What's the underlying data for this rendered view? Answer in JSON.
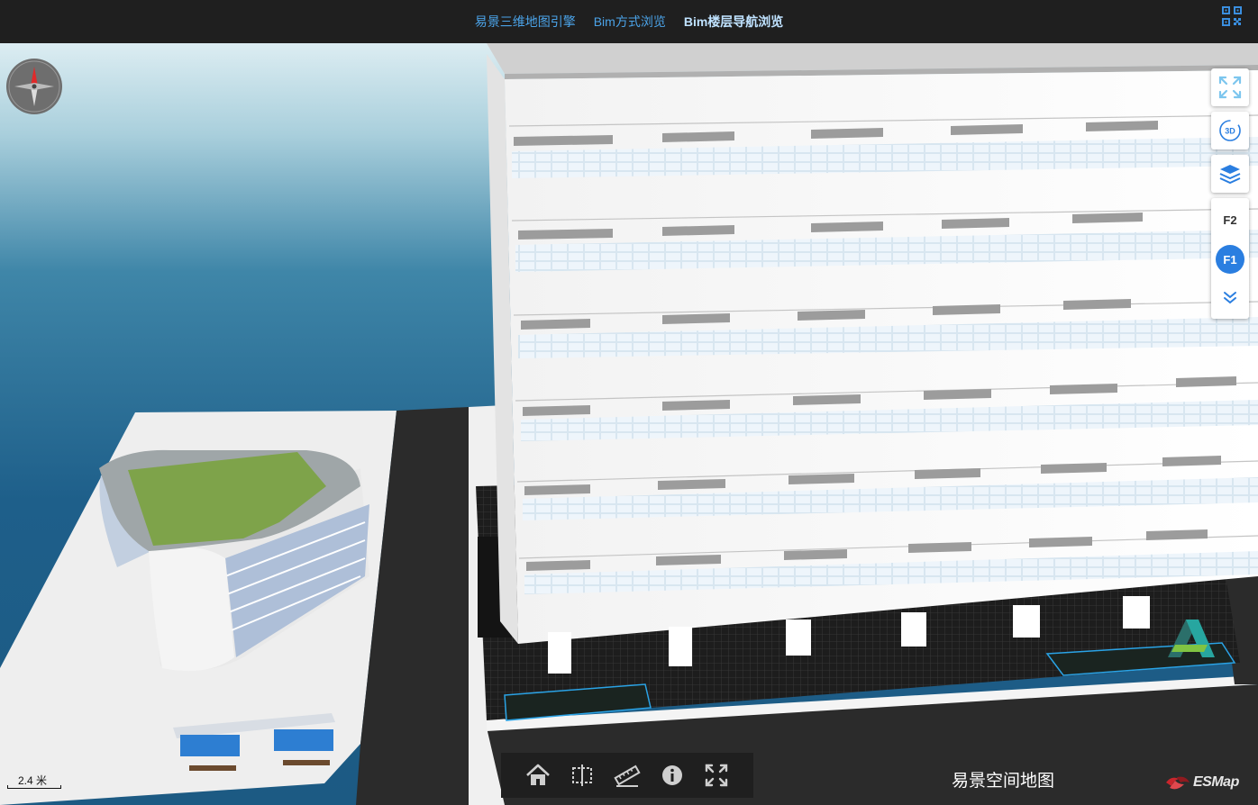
{
  "nav": {
    "items": [
      {
        "label": "易景三维地图引擎",
        "active": false
      },
      {
        "label": "Bim方式浏览",
        "active": false
      },
      {
        "label": "Bim楼层导航浏览",
        "active": true
      }
    ]
  },
  "tools": {
    "fullscreen_icon": "expand-icon",
    "view3d_label": "3D",
    "layers_icon": "layers-icon"
  },
  "floors": {
    "items": [
      "F2",
      "F1"
    ],
    "selected": "F1"
  },
  "bottom_toolbar": {
    "icons": [
      "home-icon",
      "area-measure-icon",
      "ruler-icon",
      "info-icon",
      "fullscreen-icon"
    ]
  },
  "scale": {
    "label": "2.4 米"
  },
  "map_title": "易景空间地图",
  "brand": {
    "logo_text": "ESMap"
  },
  "colors": {
    "nav_link": "#4ba3e8",
    "nav_active": "#bfe2ff",
    "floor_active": "#2a7ee0",
    "sea_top": "#d9ecf1",
    "sea_bottom": "#16507a",
    "ground": "#efefef",
    "road": "#2b2b2b"
  }
}
